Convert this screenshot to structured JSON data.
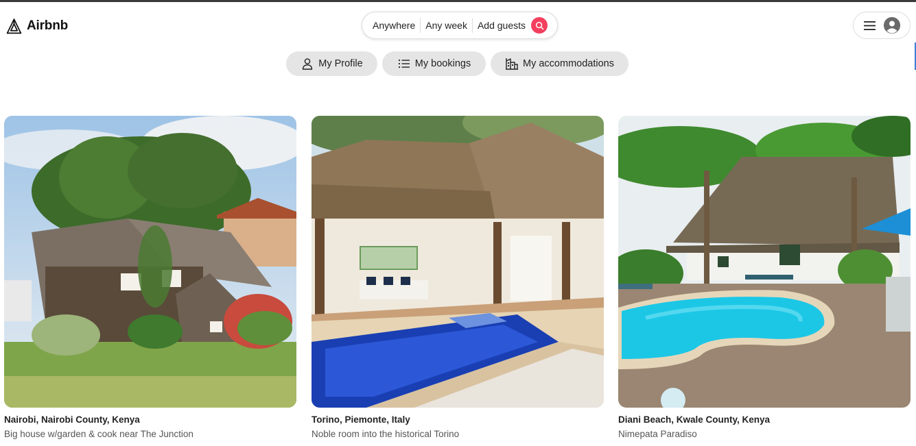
{
  "header": {
    "brand": "Airbnb",
    "search": {
      "where": "Anywhere",
      "when": "Any week",
      "who": "Add guests",
      "accent": "#f43f5e"
    },
    "user_menu": {
      "menu_icon": "hamburger-icon",
      "avatar_icon": "user-avatar-icon"
    }
  },
  "nav": {
    "tabs": [
      {
        "label": "My Profile",
        "icon": "user-icon"
      },
      {
        "label": "My bookings",
        "icon": "list-icon"
      },
      {
        "label": "My accommodations",
        "icon": "building-icon"
      }
    ]
  },
  "listings": [
    {
      "location": "Nairobi, Nairobi County, Kenya",
      "title": "Big house w/garden & cook near The Junction",
      "image": "house-with-garden-photo"
    },
    {
      "location": "Torino, Piemonte, Italy",
      "title": "Noble room into the historical Torino",
      "image": "thatched-villa-with-pool-photo"
    },
    {
      "location": "Diani Beach, Kwale County, Kenya",
      "title": "Nimepata Paradiso",
      "image": "palm-garden-pool-photo"
    }
  ]
}
